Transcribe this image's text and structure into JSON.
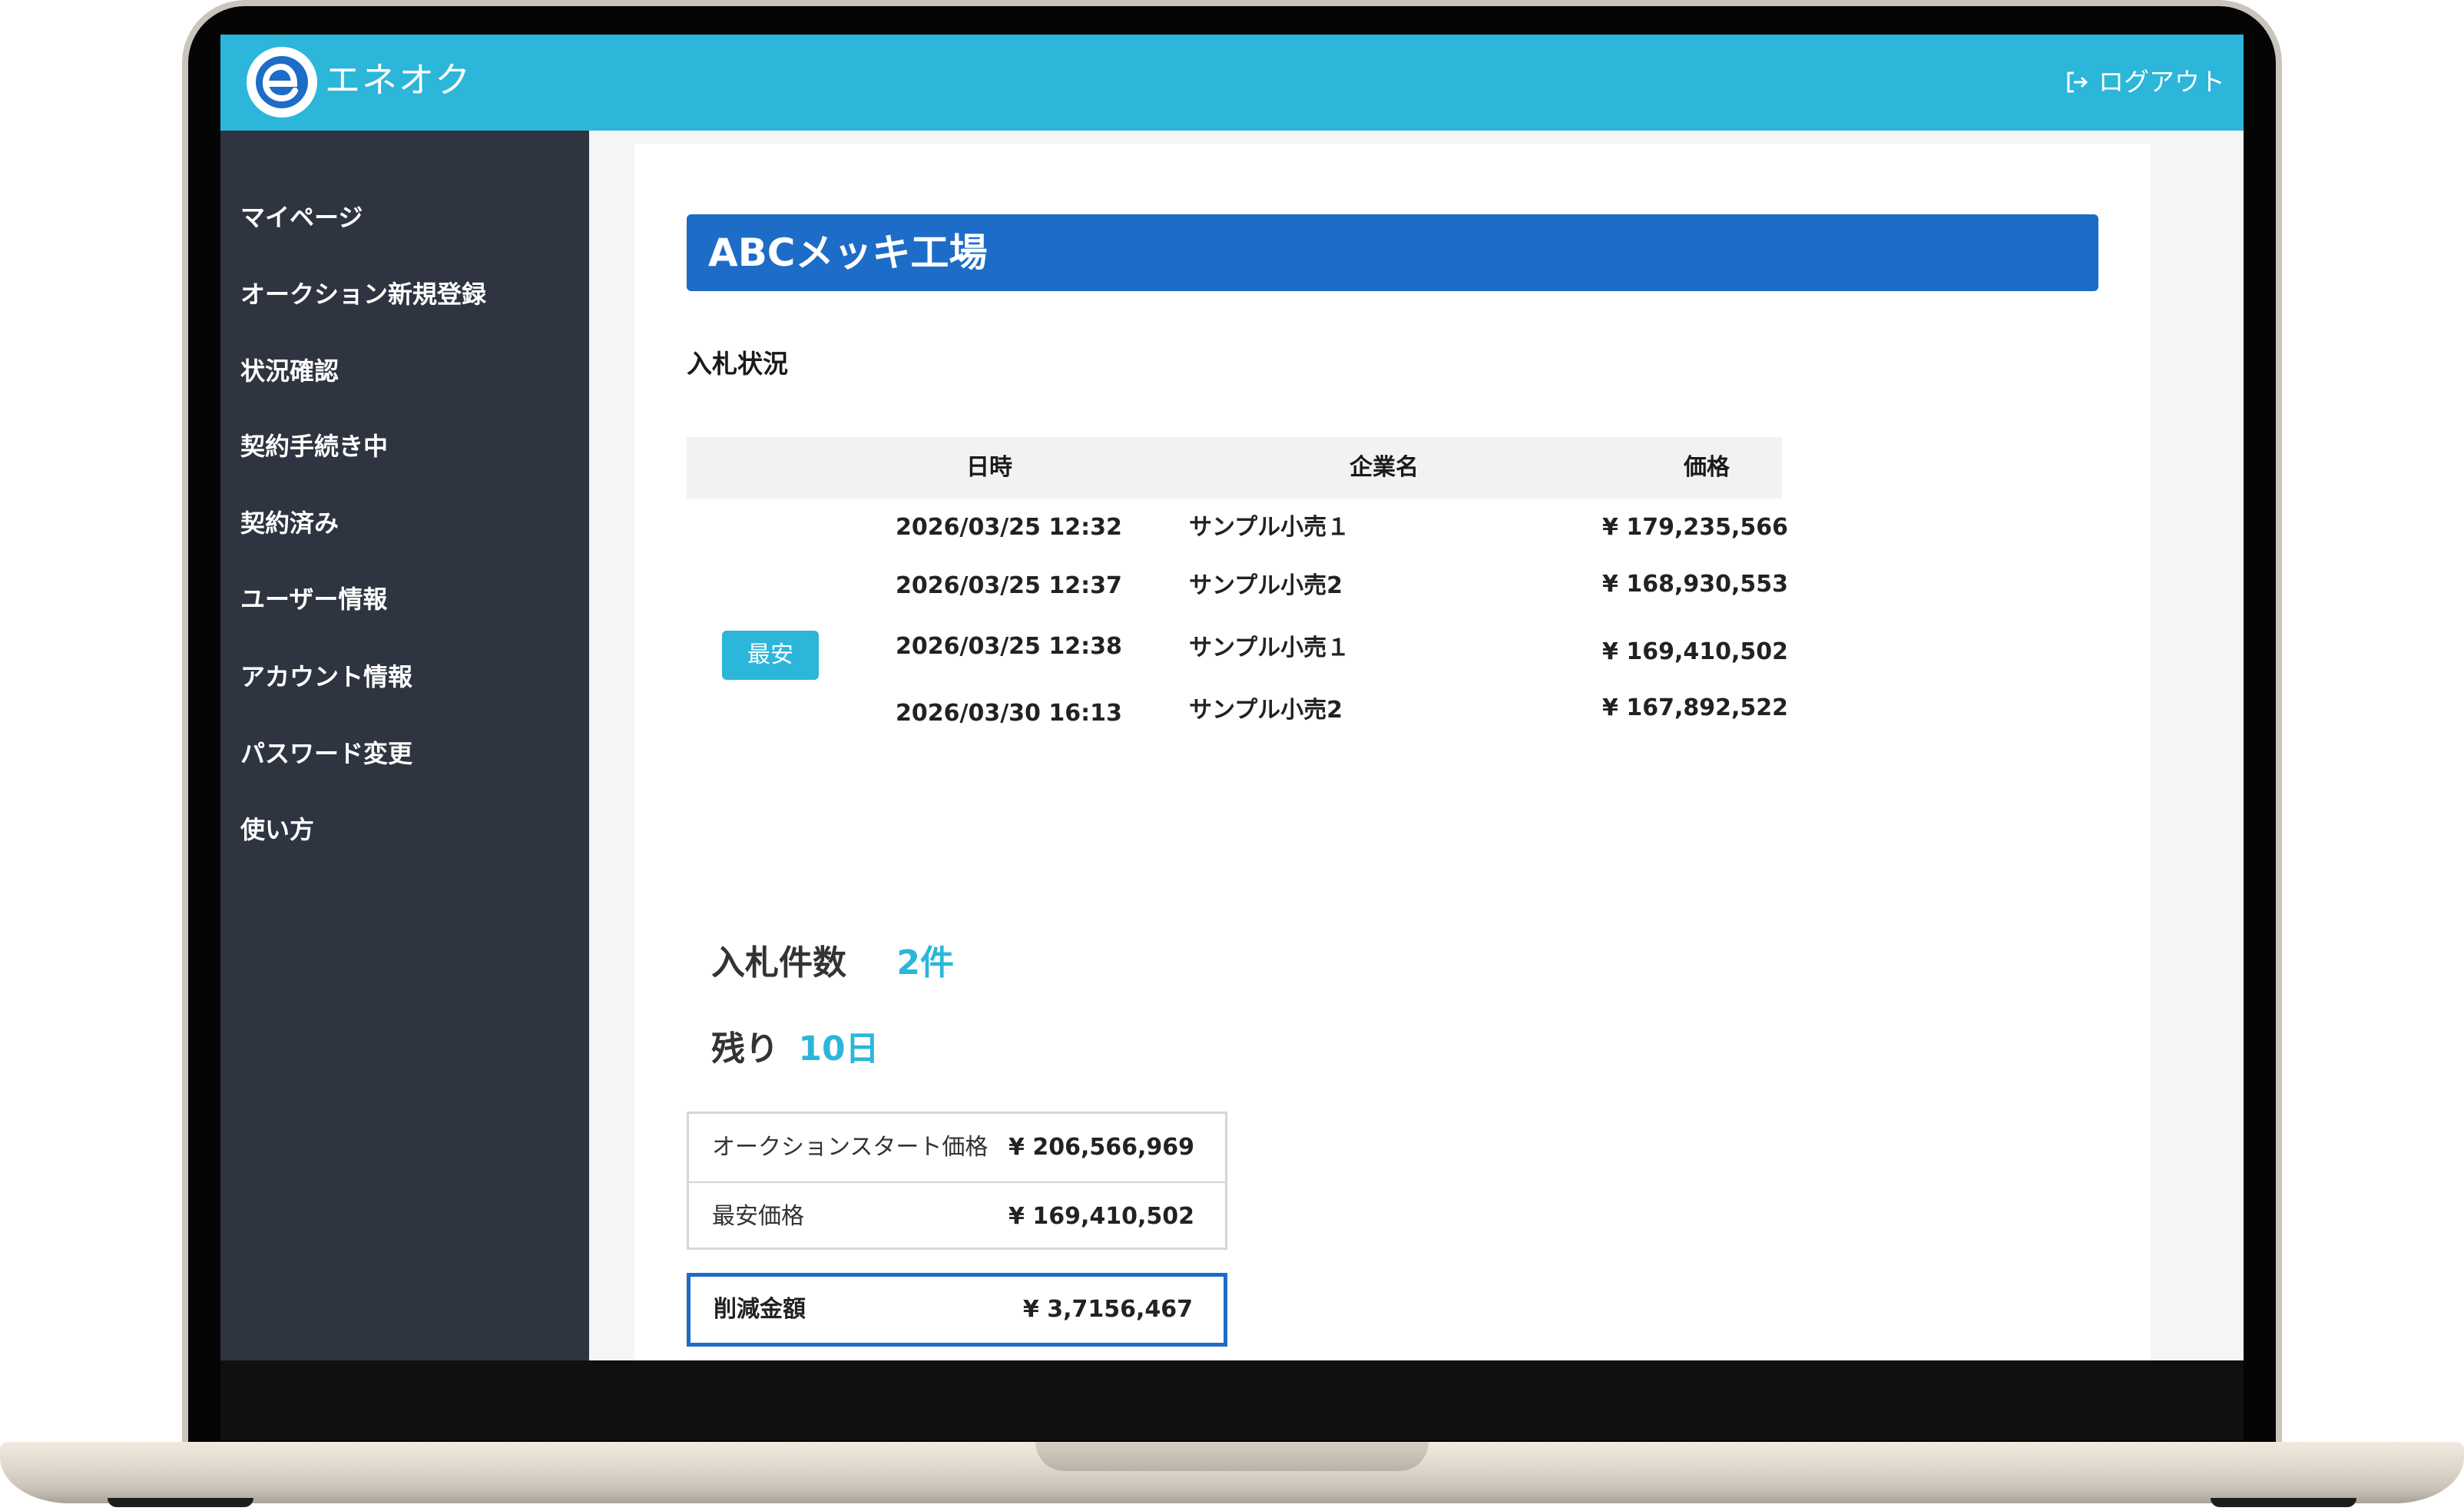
{
  "header": {
    "app_name": "エネオク",
    "logout_label": "ログアウト",
    "color": "#2bb6da"
  },
  "sidebar": {
    "items": [
      {
        "label": "マイページ"
      },
      {
        "label": "オークション新規登録"
      },
      {
        "label": "状況確認"
      },
      {
        "label": "契約手続き中"
      },
      {
        "label": "契約済み"
      },
      {
        "label": "ユーザー情報"
      },
      {
        "label": "アカウント情報"
      },
      {
        "label": "パスワード変更"
      },
      {
        "label": "使い方"
      }
    ]
  },
  "main": {
    "company_name": "ABCメッキ工場",
    "section_title": "入札状況",
    "bid_table": {
      "columns": [
        "日時",
        "企業名",
        "価格"
      ],
      "rows": [
        {
          "datetime": "2026/03/25 12:32",
          "company": "サンプル小売１",
          "price": "¥ 179,235,566"
        },
        {
          "datetime": "2026/03/25 12:37",
          "company": "サンプル小売2",
          "price": "¥ 168,930,553"
        },
        {
          "datetime": "2026/03/25 12:38",
          "company": "サンプル小売１",
          "price": "¥ 169,410,502",
          "badge": "最安"
        },
        {
          "datetime": "2026/03/30 16:13",
          "company": "サンプル小売2",
          "price": "¥ 167,892,522"
        }
      ]
    },
    "bid_count": {
      "label": "入札件数",
      "value": "2件"
    },
    "remaining": {
      "label": "残り",
      "value": "10日"
    },
    "summary": {
      "start_price_label": "オークションスタート価格",
      "start_price": "¥ 206,566,969",
      "lowest_price_label": "最安価格",
      "lowest_price": "¥ 169,410,502",
      "savings_label": "削減金額",
      "savings": "¥ 3,7156,467"
    }
  },
  "colors": {
    "accent": "#2bb6da",
    "banner": "#1d6cc7",
    "sidebar_bg": "#2e3440"
  }
}
